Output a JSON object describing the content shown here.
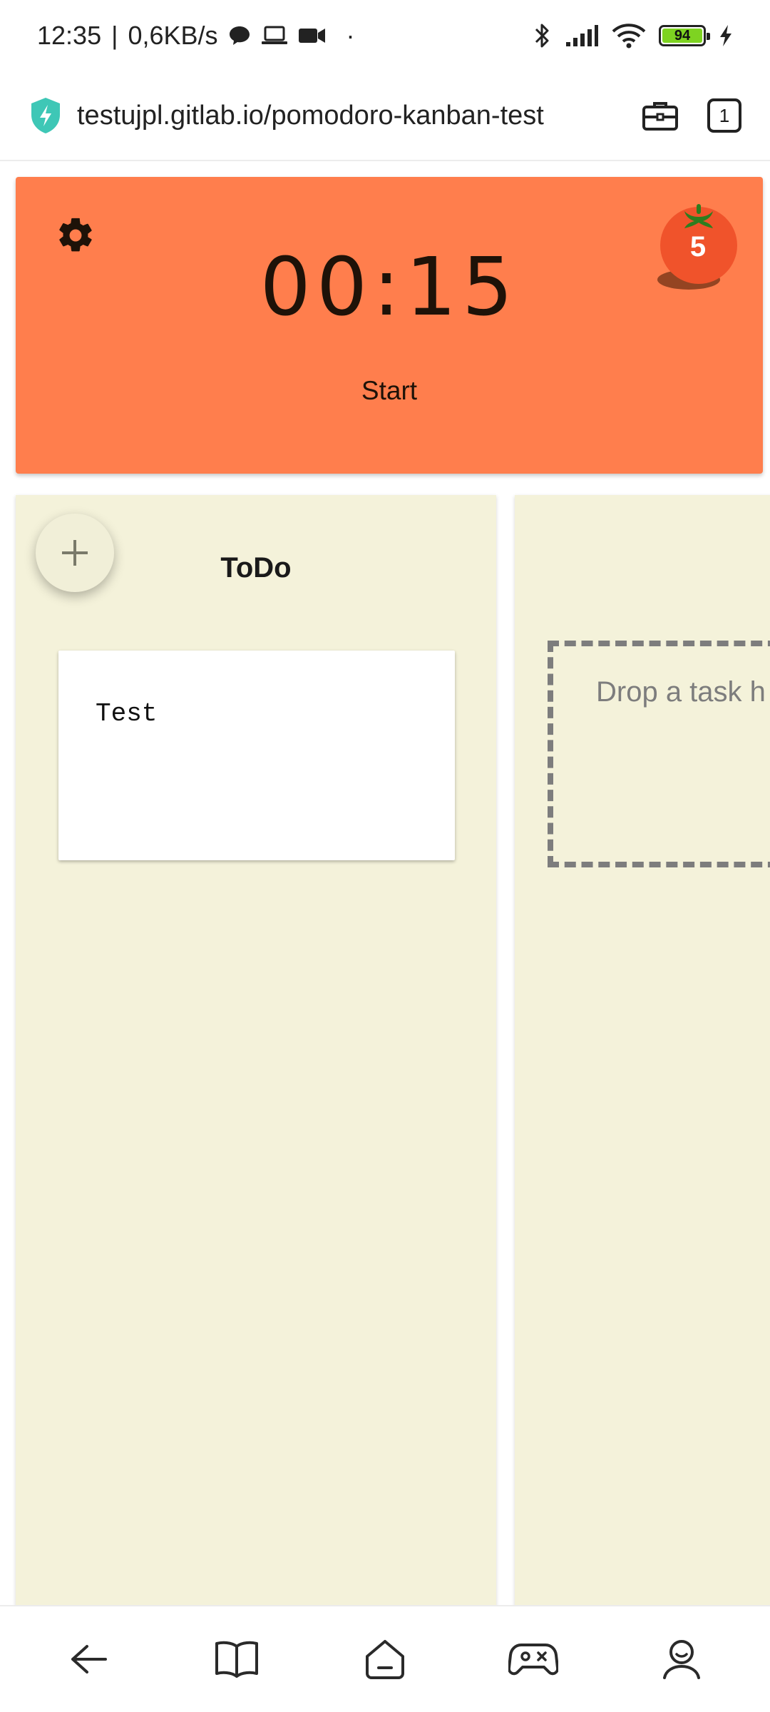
{
  "status_bar": {
    "time": "12:35",
    "separator": "|",
    "net_speed": "0,6KB/s",
    "dot": "·",
    "battery_level": "94",
    "icons": [
      "chat-bubble-icon",
      "laptop-icon",
      "video-camera-icon",
      "bluetooth-icon",
      "signal-icon",
      "wifi-icon",
      "battery-icon",
      "charging-bolt-icon"
    ]
  },
  "address_bar": {
    "url": "testujpl.gitlab.io/pomodoro-kanban-test",
    "tab_count": "1",
    "icons": [
      "shield-bolt-icon",
      "briefcase-icon"
    ]
  },
  "timer": {
    "time": "00:15",
    "start_label": "Start",
    "tomato_count": "5",
    "background_color": "#ff7e4d",
    "icons": [
      "gear-icon",
      "tomato-icon"
    ]
  },
  "board": {
    "columns": [
      {
        "title": "ToDo",
        "tasks": [
          {
            "title": "Test"
          }
        ]
      },
      {
        "drop_placeholder": "Drop a task h"
      }
    ],
    "column_background": "#f4f2da",
    "add_icon": "plus-icon"
  },
  "bottom_nav": {
    "items": [
      "back-arrow-icon",
      "book-icon",
      "home-icon",
      "gamepad-icon",
      "profile-icon"
    ]
  }
}
